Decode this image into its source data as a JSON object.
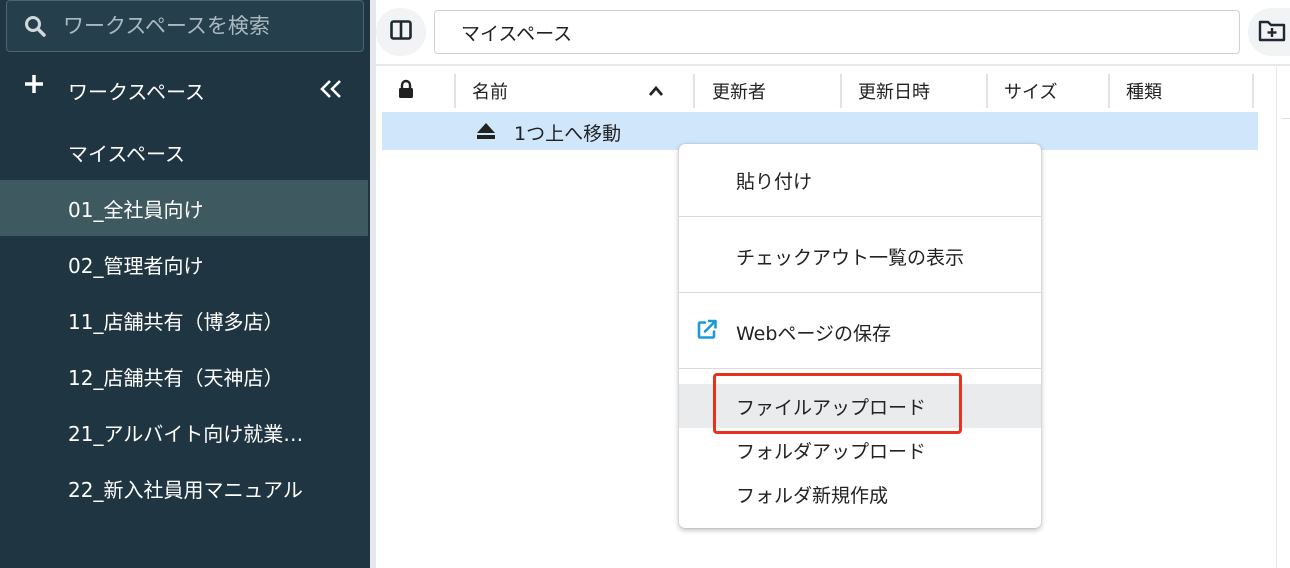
{
  "sidebar": {
    "search_placeholder": "ワークスペースを検索",
    "header_label": "ワークスペース",
    "items": [
      {
        "label": "マイスペース"
      },
      {
        "label": "01_全社員向け"
      },
      {
        "label": "02_管理者向け"
      },
      {
        "label": "11_店舗共有（博多店）"
      },
      {
        "label": "12_店舗共有（天神店）"
      },
      {
        "label": "21_アルバイト向け就業…"
      },
      {
        "label": "22_新入社員用マニュアル"
      }
    ]
  },
  "toolbar": {
    "path": "マイスペース"
  },
  "table": {
    "columns": [
      "名前",
      "更新者",
      "更新日時",
      "サイズ",
      "種類"
    ],
    "up_row_label": "1つ上へ移動"
  },
  "context_menu": {
    "items": [
      {
        "label": "貼り付け"
      },
      {
        "label": "チェックアウト一覧の表示"
      },
      {
        "label": "Webページの保存"
      },
      {
        "label": "ファイルアップロード"
      },
      {
        "label": "フォルダアップロード"
      },
      {
        "label": "フォルダ新規作成"
      }
    ]
  },
  "colors": {
    "sidebar_bg": "#1f3642",
    "sidebar_active": "#3e5a60",
    "row_selected": "#cfe6fb",
    "highlight_border": "#e8321c",
    "link_icon": "#1a9bd7"
  }
}
